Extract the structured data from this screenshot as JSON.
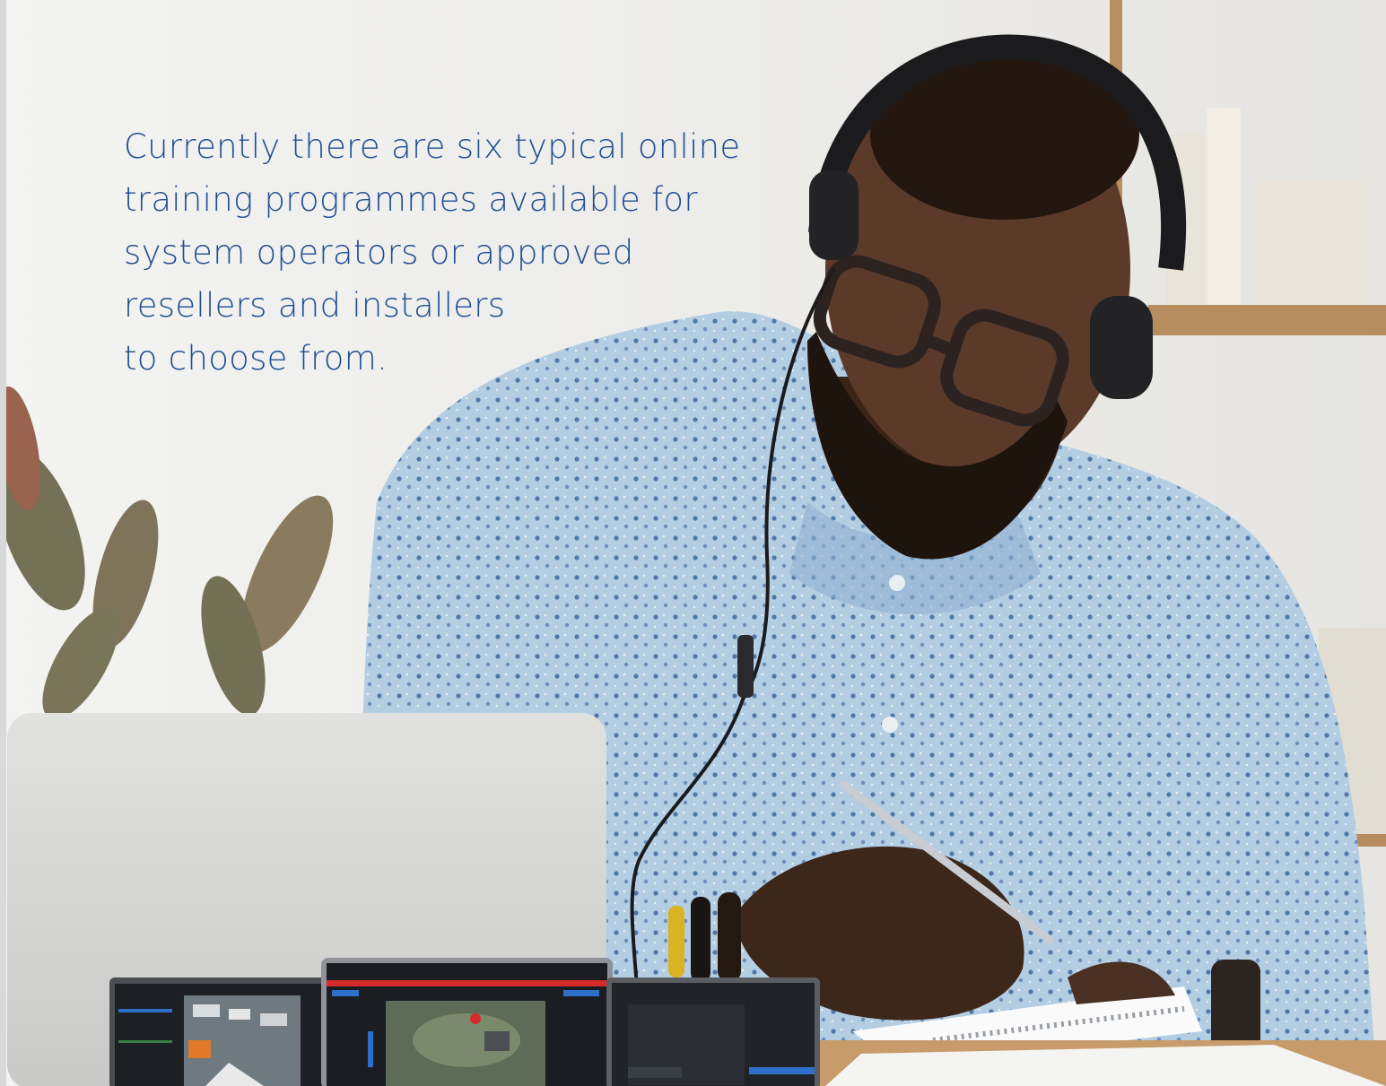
{
  "intro": {
    "lines": [
      "Currently there are six typical online",
      "training programmes available for",
      "system operators or approved",
      "resellers and installers",
      "to choose from."
    ]
  },
  "colors": {
    "text": "#1f4e93",
    "wall": "#f2f2f0",
    "shirt": "#a9c6de",
    "laptop": "#d6d6d4",
    "desk": "#c89b6a"
  }
}
